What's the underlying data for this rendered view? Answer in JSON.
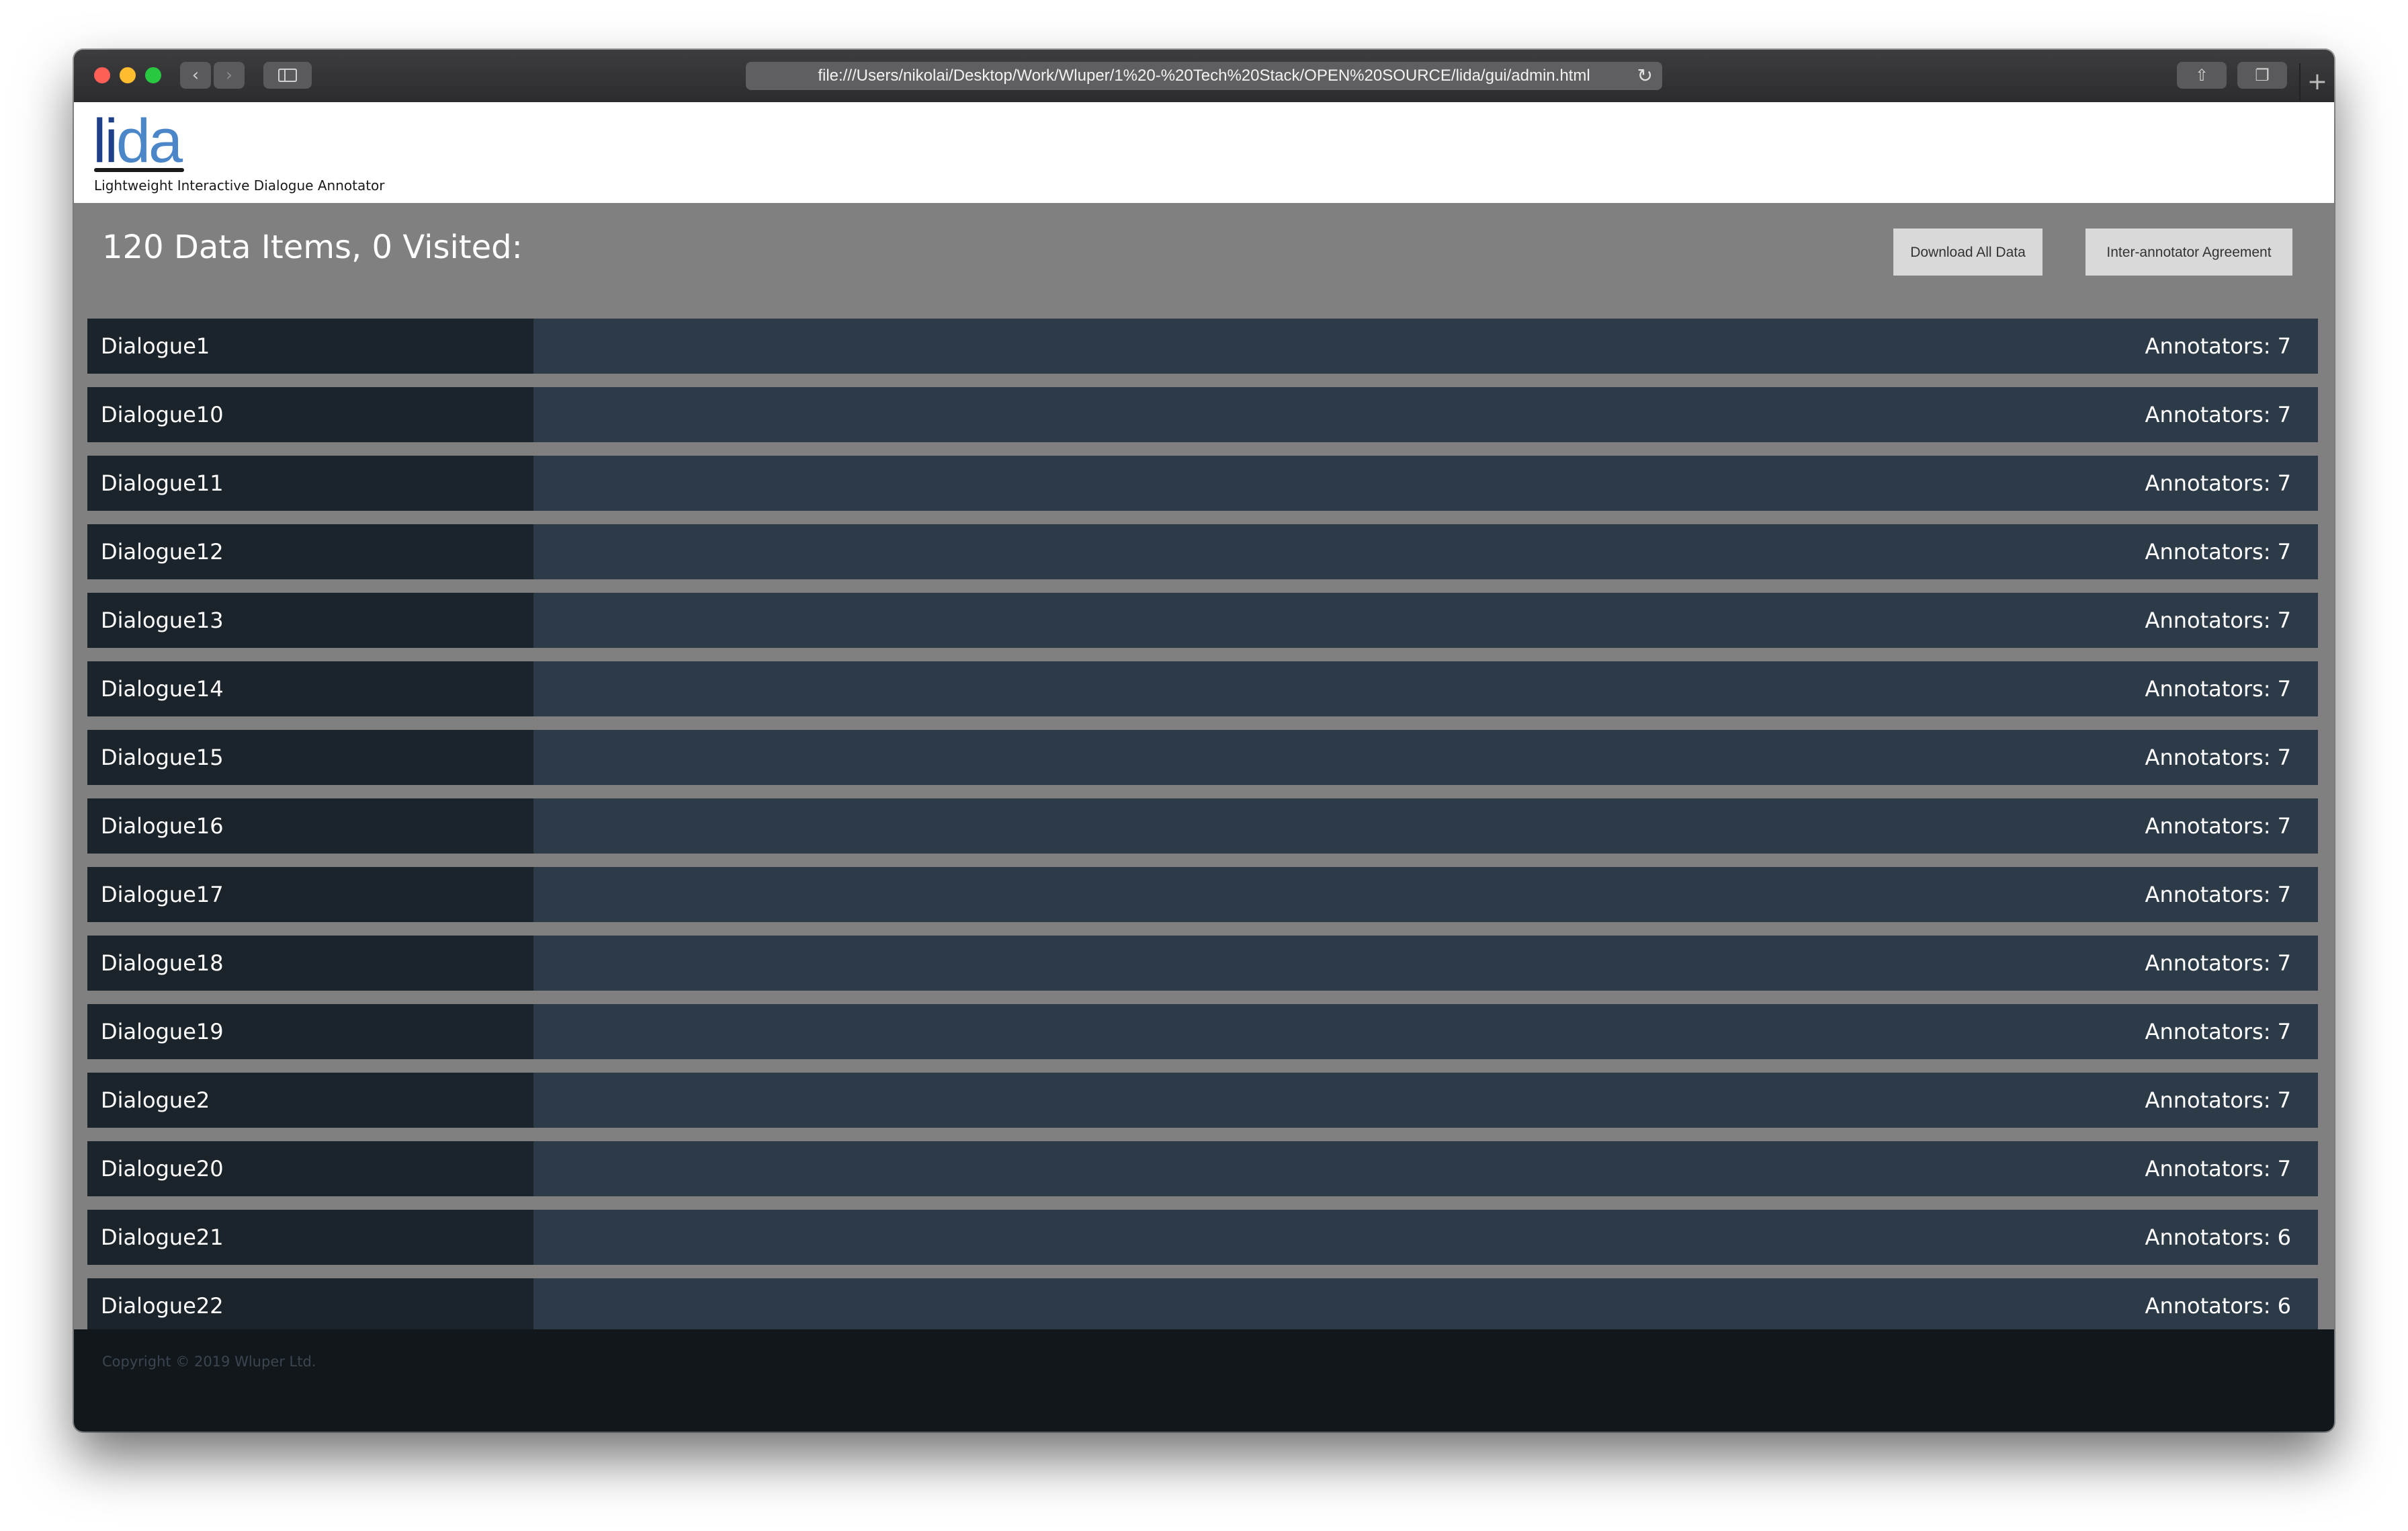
{
  "browser": {
    "url": "file:///Users/nikolai/Desktop/Work/Wluper/1%20-%20Tech%20Stack/OPEN%20SOURCE/lida/gui/admin.html"
  },
  "header": {
    "logo_text_1": "li",
    "logo_text_2": "da",
    "tagline": "Lightweight Interactive Dialogue Annotator"
  },
  "main": {
    "summary": "120 Data Items, 0 Visited:",
    "download_label": "Download All Data",
    "agreement_label": "Inter-annotator Agreement",
    "items": [
      {
        "name": "Dialogue1",
        "annotators": "Annotators: 7"
      },
      {
        "name": "Dialogue10",
        "annotators": "Annotators: 7"
      },
      {
        "name": "Dialogue11",
        "annotators": "Annotators: 7"
      },
      {
        "name": "Dialogue12",
        "annotators": "Annotators: 7"
      },
      {
        "name": "Dialogue13",
        "annotators": "Annotators: 7"
      },
      {
        "name": "Dialogue14",
        "annotators": "Annotators: 7"
      },
      {
        "name": "Dialogue15",
        "annotators": "Annotators: 7"
      },
      {
        "name": "Dialogue16",
        "annotators": "Annotators: 7"
      },
      {
        "name": "Dialogue17",
        "annotators": "Annotators: 7"
      },
      {
        "name": "Dialogue18",
        "annotators": "Annotators: 7"
      },
      {
        "name": "Dialogue19",
        "annotators": "Annotators: 7"
      },
      {
        "name": "Dialogue2",
        "annotators": "Annotators: 7"
      },
      {
        "name": "Dialogue20",
        "annotators": "Annotators: 7"
      },
      {
        "name": "Dialogue21",
        "annotators": "Annotators: 6"
      },
      {
        "name": "Dialogue22",
        "annotators": "Annotators: 6"
      }
    ]
  },
  "footer": {
    "copyright": "Copyright © 2019 Wluper Ltd."
  },
  "colors": {
    "row_name_bg": "#1b232b",
    "row_bg": "#2d3a48",
    "page_bg": "#808080",
    "footer_bg": "#12171c"
  }
}
